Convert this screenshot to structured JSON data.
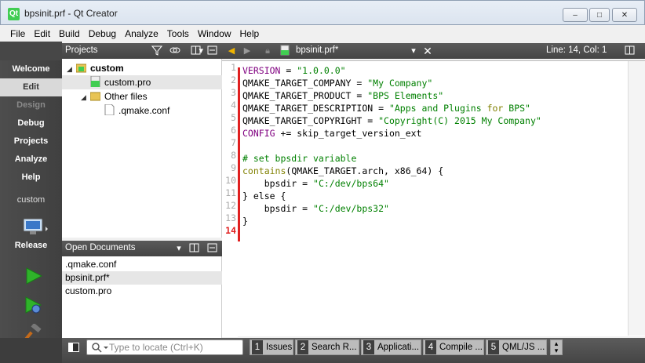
{
  "window": {
    "title": "bpsinit.prf - Qt Creator",
    "app_icon": "Qt",
    "minimize": "–",
    "maximize": "□",
    "close": "✕"
  },
  "menu": [
    "File",
    "Edit",
    "Build",
    "Debug",
    "Analyze",
    "Tools",
    "Window",
    "Help"
  ],
  "modes": [
    {
      "label": "Welcome",
      "state": "normal"
    },
    {
      "label": "Edit",
      "state": "active"
    },
    {
      "label": "Design",
      "state": "disabled"
    },
    {
      "label": "Debug",
      "state": "normal"
    },
    {
      "label": "Projects",
      "state": "normal"
    },
    {
      "label": "Analyze",
      "state": "normal"
    },
    {
      "label": "Help",
      "state": "normal"
    }
  ],
  "kit": {
    "project": "custom",
    "build": "Release"
  },
  "projects_panel": {
    "title": "Projects",
    "selector_icon": "▾"
  },
  "tree": [
    {
      "label": "custom",
      "depth": 0,
      "bold": true,
      "expanded": true,
      "icon": "project-folder-icon"
    },
    {
      "label": "custom.pro",
      "depth": 1,
      "selected": true,
      "icon": "pro-file-icon"
    },
    {
      "label": "Other files",
      "depth": 1,
      "expanded": true,
      "icon": "folder-icon"
    },
    {
      "label": ".qmake.conf",
      "depth": 2,
      "icon": "file-icon"
    }
  ],
  "open_documents": {
    "title": "Open Documents",
    "items": [
      {
        "label": ".qmake.conf",
        "selected": false
      },
      {
        "label": "bpsinit.prf*",
        "selected": true
      },
      {
        "label": "custom.pro",
        "selected": false
      }
    ]
  },
  "editor": {
    "file_label": "bpsinit.prf*",
    "position": "Line: 14, Col: 1",
    "line_numbers": [
      "1",
      "2",
      "3",
      "4",
      "5",
      "6",
      "7",
      "8",
      "9",
      "10",
      "11",
      "12",
      "13",
      "14"
    ],
    "lines": [
      [
        {
          "t": "VERSION",
          "c": "v"
        },
        {
          "t": " = "
        },
        {
          "t": "\"1.0.0.0\"",
          "c": "s"
        }
      ],
      [
        {
          "t": "QMAKE_TARGET_COMPANY = "
        },
        {
          "t": "\"My Company\"",
          "c": "s"
        }
      ],
      [
        {
          "t": "QMAKE_TARGET_PRODUCT = "
        },
        {
          "t": "\"BPS Elements\"",
          "c": "s"
        }
      ],
      [
        {
          "t": "QMAKE_TARGET_DESCRIPTION = "
        },
        {
          "t": "\"Apps and Plugins ",
          "c": "s"
        },
        {
          "t": "for",
          "c": "k"
        },
        {
          "t": " BPS\"",
          "c": "s"
        }
      ],
      [
        {
          "t": "QMAKE_TARGET_COPYRIGHT = "
        },
        {
          "t": "\"Copyright(C) 2015 My Company\"",
          "c": "s"
        }
      ],
      [
        {
          "t": "CONFIG",
          "c": "v"
        },
        {
          "t": " += skip_target_version_ext"
        }
      ],
      [],
      [
        {
          "t": "# set bpsdir variable",
          "c": "c"
        }
      ],
      [
        {
          "t": "contains",
          "c": "k"
        },
        {
          "t": "(QMAKE_TARGET.arch, x86_64) {"
        }
      ],
      [
        {
          "t": "    bpsdir = "
        },
        {
          "t": "\"C:/dev/bps64\"",
          "c": "s"
        }
      ],
      [
        {
          "t": "} else {"
        }
      ],
      [
        {
          "t": "    bpsdir = "
        },
        {
          "t": "\"C:/dev/bps32\"",
          "c": "s"
        }
      ],
      [
        {
          "t": "}"
        }
      ],
      []
    ]
  },
  "locator": {
    "placeholder": "Type to locate (Ctrl+K)"
  },
  "output_tabs": [
    {
      "num": "1",
      "label": "Issues"
    },
    {
      "num": "2",
      "label": "Search R..."
    },
    {
      "num": "3",
      "label": "Applicati..."
    },
    {
      "num": "4",
      "label": "Compile ..."
    },
    {
      "num": "5",
      "label": "QML/JS ..."
    }
  ],
  "colors": {
    "accent": "#41cd52",
    "mark": "#e02020",
    "panel_dark": "#444444"
  }
}
